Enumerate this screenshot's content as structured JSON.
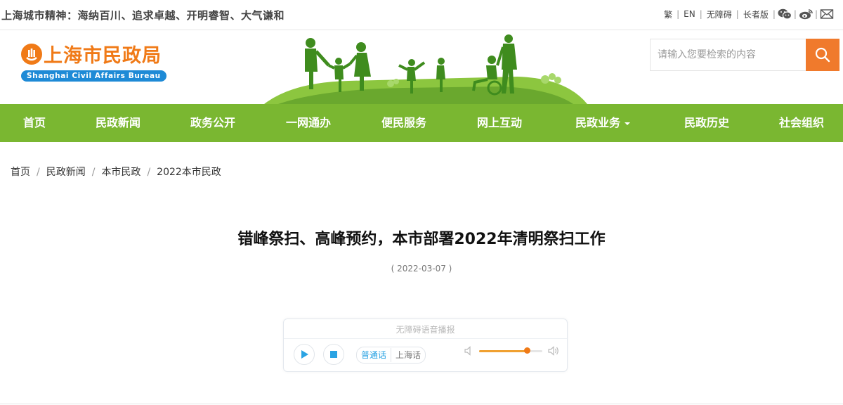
{
  "topbar": {
    "motto": "上海城市精神：海纳百川、追求卓越、开明睿智、大气谦和",
    "links": {
      "traditional": "繁",
      "english": "EN",
      "accessible": "无障碍",
      "elder": "长者版"
    }
  },
  "header": {
    "logo_cn": "上海市民政局",
    "logo_en": "Shanghai Civil Affairs Bureau",
    "search_placeholder": "请输入您要检索的内容"
  },
  "nav": {
    "items": [
      "首页",
      "民政新闻",
      "政务公开",
      "一网通办",
      "便民服务",
      "网上互动",
      "民政业务",
      "民政历史",
      "社会组织"
    ]
  },
  "breadcrumb": [
    "首页",
    "民政新闻",
    "本市民政",
    "2022本市民政"
  ],
  "article": {
    "title": "错峰祭扫、高峰预约，本市部署2022年清明祭扫工作",
    "date": "( 2022-03-07 )"
  },
  "player": {
    "label": "无障碍语音播报",
    "lang_mandarin": "普通话",
    "lang_shanghainese": "上海话",
    "selected_lang": "普通话",
    "volume": 0.76
  },
  "colors": {
    "nav_green": "#7ab731",
    "brand_orange": "#f07a17",
    "search_orange": "#f07a2c",
    "logo_blue": "#1e8ad6",
    "player_blue": "#2aa3e3"
  }
}
